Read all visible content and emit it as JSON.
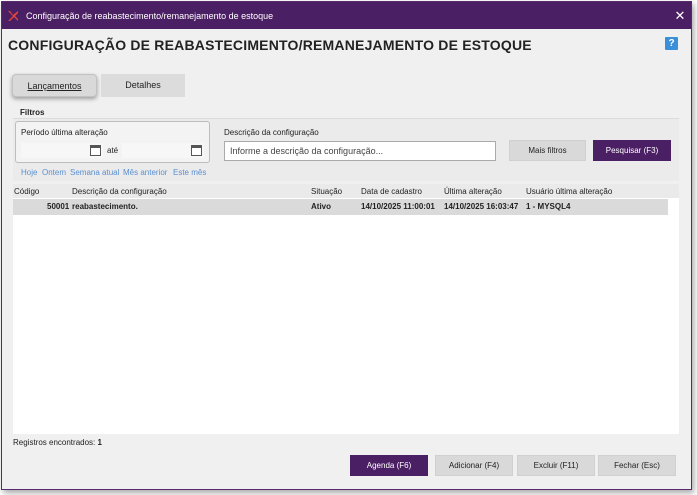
{
  "window": {
    "title": "Configuração de reabastecimento/remanejamento de estoque",
    "close_glyph": "✕"
  },
  "page": {
    "title": "CONFIGURAÇÃO DE REABASTECIMENTO/REMANEJAMENTO DE ESTOQUE",
    "help_glyph": "?"
  },
  "tabs": [
    {
      "label": "Lançamentos",
      "active": true
    },
    {
      "label": "Detalhes",
      "active": false
    }
  ],
  "filters": {
    "label": "Filtros",
    "period_label": "Período última alteração",
    "date_from": "",
    "date_to": "",
    "between_label": "até",
    "quick_links": [
      "Hoje",
      "Ontem",
      "Semana atual",
      "Mês anterior",
      "Este mês"
    ],
    "description_label": "Descrição da configuração",
    "description_placeholder": "Informe a descrição da configuração...",
    "more_filters_label": "Mais filtros",
    "search_label": "Pesquisar (F3)"
  },
  "grid": {
    "columns": [
      "Código",
      "Descrição da configuração",
      "Situação",
      "Data de cadastro",
      "Última alteração",
      "Usuário última alteração"
    ],
    "rows": [
      {
        "code": "50001",
        "description": "reabastecimento.",
        "status": "Ativo",
        "created": "14/10/2025 11:00:01",
        "updated": "14/10/2025 16:03:47",
        "user": "1 - MYSQL4"
      }
    ]
  },
  "footer": {
    "records_label": "Registros encontrados:",
    "records_count": "1",
    "buttons": {
      "agenda": "Agenda (F6)",
      "add": "Adicionar (F4)",
      "delete": "Excluir (F11)",
      "close": "Fechar (Esc)"
    }
  },
  "colors": {
    "brand": "#4b1f63",
    "link": "#5a8fd0",
    "help": "#3a8fd8"
  },
  "icons": [
    "app-logo-icon",
    "close-icon",
    "help-icon",
    "calendar-icon"
  ]
}
